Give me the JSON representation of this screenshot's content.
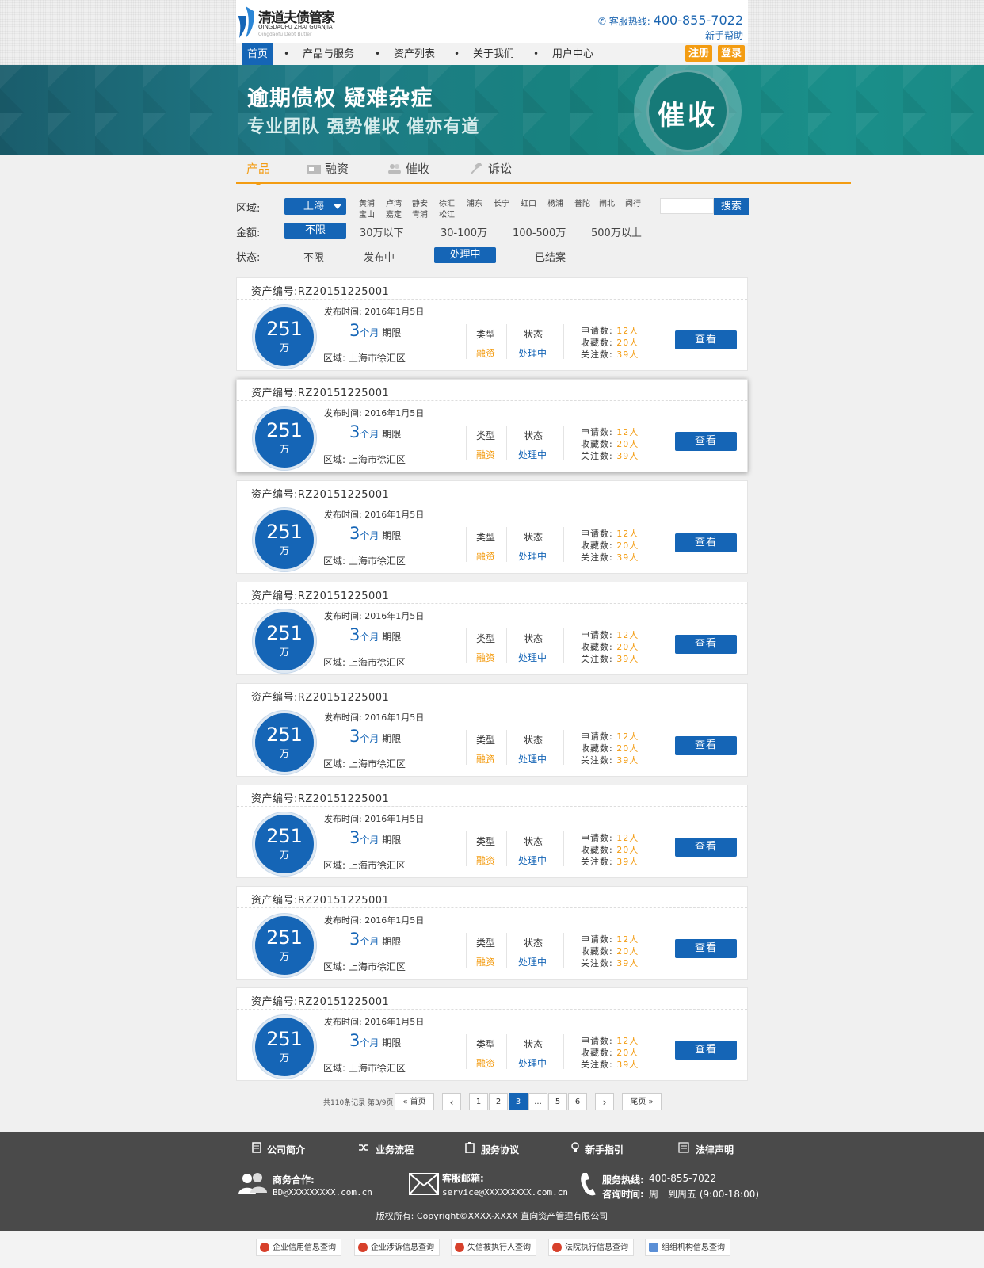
{
  "header": {
    "logo_cn": "清道夫债管家",
    "logo_en": "QINGDAOFU ZHAI GUANJIA",
    "logo_en_small": "Qingdaofu Debt Butler",
    "hotline_label": "客服热线:",
    "hotline_number": "400-855-7022",
    "help": "新手帮助"
  },
  "nav": {
    "items": [
      "首页",
      "产品与服务",
      "资产列表",
      "关于我们",
      "用户中心"
    ],
    "register": "注册",
    "login": "登录"
  },
  "banner": {
    "line1": "逾期债权  疑难杂症",
    "line2": "专业团队  强势催收  催亦有道",
    "seal": "催收"
  },
  "tabs": [
    "产品",
    "融资",
    "催收",
    "诉讼"
  ],
  "filters": {
    "region_label": "区域:",
    "region_selected": "上海",
    "districts_row1": [
      "黄浦",
      "卢湾",
      "静安",
      "徐汇",
      "浦东",
      "长宁",
      "虹口",
      "杨浦",
      "普陀",
      "闸北",
      "闵行"
    ],
    "districts_row2": [
      "宝山",
      "嘉定",
      "青浦",
      "松江"
    ],
    "search_button": "搜索",
    "amount_label": "金额:",
    "amount_options": [
      "不限",
      "30万以下",
      "30-100万",
      "100-500万",
      "500万以上"
    ],
    "status_label": "状态:",
    "status_options": [
      "不限",
      "发布中",
      "处理中",
      "已结案"
    ]
  },
  "card_labels": {
    "asset_prefix": "资产编号:",
    "pub_prefix": "发布时间:",
    "term_unit": "个月",
    "term_suffix": "期限",
    "area_prefix": "区域:",
    "type_label": "类型",
    "state_label": "状态",
    "apply_label": "申请数:",
    "fav_label": "收藏数:",
    "follow_label": "关注数:",
    "view_button": "查看"
  },
  "listings": [
    {
      "asset_no": "RZ20151225001",
      "amount": "251",
      "amount_unit": "万",
      "pub_time": "2016年1月5日",
      "term": "3",
      "area": "上海市徐汇区",
      "type": "融资",
      "state": "处理中",
      "applies": "12人",
      "favorites": "20人",
      "follows": "39人"
    },
    {
      "asset_no": "RZ20151225001",
      "amount": "251",
      "amount_unit": "万",
      "pub_time": "2016年1月5日",
      "term": "3",
      "area": "上海市徐汇区",
      "type": "融资",
      "state": "处理中",
      "applies": "12人",
      "favorites": "20人",
      "follows": "39人"
    },
    {
      "asset_no": "RZ20151225001",
      "amount": "251",
      "amount_unit": "万",
      "pub_time": "2016年1月5日",
      "term": "3",
      "area": "上海市徐汇区",
      "type": "融资",
      "state": "处理中",
      "applies": "12人",
      "favorites": "20人",
      "follows": "39人"
    },
    {
      "asset_no": "RZ20151225001",
      "amount": "251",
      "amount_unit": "万",
      "pub_time": "2016年1月5日",
      "term": "3",
      "area": "上海市徐汇区",
      "type": "融资",
      "state": "处理中",
      "applies": "12人",
      "favorites": "20人",
      "follows": "39人"
    },
    {
      "asset_no": "RZ20151225001",
      "amount": "251",
      "amount_unit": "万",
      "pub_time": "2016年1月5日",
      "term": "3",
      "area": "上海市徐汇区",
      "type": "融资",
      "state": "处理中",
      "applies": "12人",
      "favorites": "20人",
      "follows": "39人"
    },
    {
      "asset_no": "RZ20151225001",
      "amount": "251",
      "amount_unit": "万",
      "pub_time": "2016年1月5日",
      "term": "3",
      "area": "上海市徐汇区",
      "type": "融资",
      "state": "处理中",
      "applies": "12人",
      "favorites": "20人",
      "follows": "39人"
    },
    {
      "asset_no": "RZ20151225001",
      "amount": "251",
      "amount_unit": "万",
      "pub_time": "2016年1月5日",
      "term": "3",
      "area": "上海市徐汇区",
      "type": "融资",
      "state": "处理中",
      "applies": "12人",
      "favorites": "20人",
      "follows": "39人"
    },
    {
      "asset_no": "RZ20151225001",
      "amount": "251",
      "amount_unit": "万",
      "pub_time": "2016年1月5日",
      "term": "3",
      "area": "上海市徐汇区",
      "type": "融资",
      "state": "处理中",
      "applies": "12人",
      "favorites": "20人",
      "follows": "39人"
    }
  ],
  "pagination": {
    "info": "共110条记录 第3/9页",
    "first": "« 首页",
    "prev": "‹",
    "pages": [
      "1",
      "2",
      "3",
      "...",
      "5",
      "6"
    ],
    "current": "3",
    "next": "›",
    "last": "尾页 »"
  },
  "footer": {
    "links": [
      "公司简介",
      "业务流程",
      "服务协议",
      "新手指引",
      "法律声明"
    ],
    "business_label": "商务合作:",
    "business_email": "BD@XXXXXXXXX.com.cn",
    "service_label": "客服邮箱:",
    "service_email": "service@XXXXXXXXX.com.cn",
    "hotline_label": "服务热线:",
    "hotline": "400-855-7022",
    "hours_label": "咨询时间:",
    "hours": "周一到周五 (9:00-18:00)",
    "copyright": "版权所有: Copyright©XXXX-XXXX 直向资产管理有限公司"
  },
  "bottom_badges": [
    "企业信用信息查询",
    "企业涉诉信息查询",
    "失信被执行人查询",
    "法院执行信息查询",
    "组组机构信息查询"
  ],
  "colors": {
    "primary": "#1565b6",
    "accent": "#f39c12",
    "footer": "#4a4a4a",
    "banner": "#1a8a86"
  }
}
